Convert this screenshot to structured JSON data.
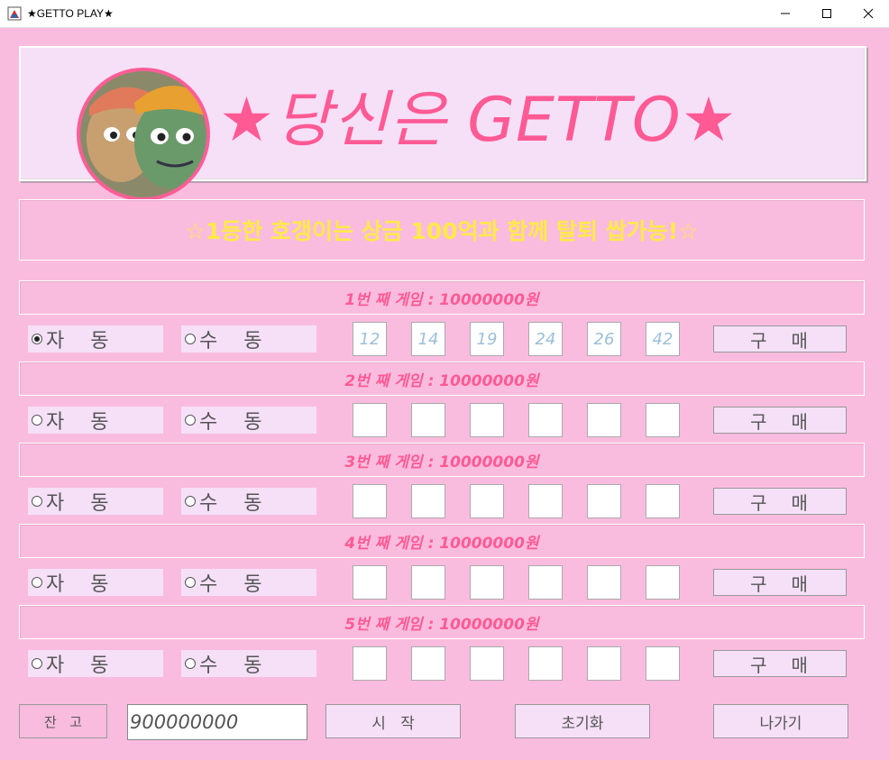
{
  "window": {
    "title": "★GETTO PLAY★"
  },
  "banner": {
    "title": "★당신은 GETTO★"
  },
  "notice": {
    "text": "☆1등한 호갱이는 상금 100억과 함께 탈퇴 쌉가능!☆"
  },
  "games": [
    {
      "header": "1번 째 게임 : 10000000원",
      "auto_label": "자   동",
      "manual_label": "수   동",
      "mode": "auto",
      "numbers": [
        "12",
        "14",
        "19",
        "24",
        "26",
        "42"
      ],
      "buy_label": "구   매"
    },
    {
      "header": "2번 째 게임 : 10000000원",
      "auto_label": "자   동",
      "manual_label": "수   동",
      "mode": "none",
      "numbers": [
        "",
        "",
        "",
        "",
        "",
        ""
      ],
      "buy_label": "구   매"
    },
    {
      "header": "3번 째 게임 : 10000000원",
      "auto_label": "자   동",
      "manual_label": "수   동",
      "mode": "none",
      "numbers": [
        "",
        "",
        "",
        "",
        "",
        ""
      ],
      "buy_label": "구   매"
    },
    {
      "header": "4번 째 게임 : 10000000원",
      "auto_label": "자   동",
      "manual_label": "수   동",
      "mode": "none",
      "numbers": [
        "",
        "",
        "",
        "",
        "",
        ""
      ],
      "buy_label": "구   매"
    },
    {
      "header": "5번 째 게임 : 10000000원",
      "auto_label": "자   동",
      "manual_label": "수   동",
      "mode": "none",
      "numbers": [
        "",
        "",
        "",
        "",
        "",
        ""
      ],
      "buy_label": "구   매"
    }
  ],
  "footer": {
    "balance_label": "잔   고",
    "balance_value": "900000000",
    "start_label": "시   작",
    "reset_label": "초기화",
    "exit_label": "나가기"
  },
  "icons": {
    "app": "app-icon",
    "minimize": "minimize-icon",
    "maximize": "maximize-icon",
    "close": "close-icon"
  },
  "colors": {
    "background": "#f9bcde",
    "panel": "#f5e0f8",
    "accent": "#ff5a94",
    "notice": "#ffe94a"
  }
}
